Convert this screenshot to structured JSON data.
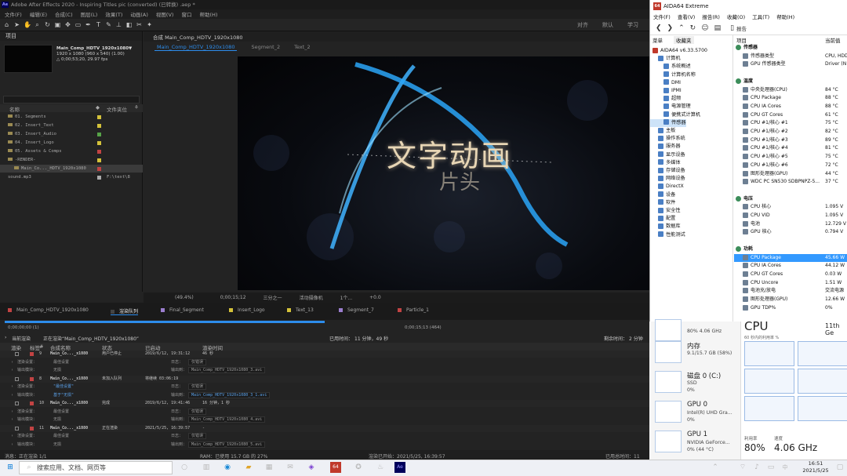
{
  "ae": {
    "title": "Adobe After Effects 2020 - Inspiring Titles pic (converted) (已转换) .aep *",
    "logo": "Ae",
    "menu": [
      "文件(F)",
      "编辑(E)",
      "合成(C)",
      "图层(L)",
      "效果(T)",
      "动画(A)",
      "视图(V)",
      "窗口",
      "帮助(H)"
    ],
    "tools_right": [
      "对齐",
      "默认",
      "学习"
    ],
    "project": {
      "tab": "项目",
      "comp_name": "Main_Comp_HDTV_1920x1080▼",
      "comp_size": "1920 x 1080 (960 x 540) (1.00)",
      "comp_dur": "△ 0;00;53;20, 29.97 fps",
      "col_name": "名称",
      "col_tag": "文件夹位",
      "items": [
        {
          "name": "01. Segments",
          "color": "#d4c23a"
        },
        {
          "name": "02. Insert_Text",
          "color": "#d4c23a"
        },
        {
          "name": "03. Insert_Audio",
          "color": "#56a448"
        },
        {
          "name": "04. Insert_Logo",
          "color": "#d4c23a"
        },
        {
          "name": "05. Assets & Comps",
          "color": "#c24343"
        },
        {
          "name": "-RENDER-",
          "color": "#d4c23a"
        },
        {
          "name": "Main_Co..._HDTV_1920x1080",
          "color": "#c24343"
        },
        {
          "name": "sound.mp3",
          "color": "#aaaaaa",
          "tag": "F:\\text\\8"
        }
      ]
    },
    "viewer": {
      "tab": "合成 Main_Comp_HDTV_1920x1080",
      "subtabs": [
        "Main_Comp_HDTV_1920x1080",
        "Segment_2",
        "Text_2"
      ],
      "title_main": "文字动画",
      "title_sub": "片头",
      "bar": [
        "(49.4%)",
        "0;00;15;12",
        "三分之一",
        "活动摄像机",
        "1个...",
        "+0.0"
      ]
    },
    "rq": {
      "tabs": [
        {
          "label": "Main_Comp_HDTV_1920x1080",
          "color": "#c24343"
        },
        {
          "label": "渲染队列",
          "color": "#444444"
        },
        {
          "label": "Final_Segment",
          "color": "#9b7ecf"
        },
        {
          "label": "Insert_Logo",
          "color": "#d4c23a"
        },
        {
          "label": "Text_13",
          "color": "#d4c23a"
        },
        {
          "label": "Segment_7",
          "color": "#9b7ecf"
        },
        {
          "label": "Particle_1",
          "color": "#c24343"
        }
      ],
      "progress": 0.5,
      "time_start": "0;00;00;00 (1)",
      "time_mid": "0;00;15;13 (464)",
      "status_label": "当前渲染",
      "status_text": "正在渲染“Main_Comp_HDTV_1920x1080”",
      "elapsed_label": "已用时间：",
      "elapsed": "11 分钟，49 秒",
      "remain_label": "剩余时间：",
      "remain": "2 分钟",
      "headers": [
        "渲染",
        "标签",
        "#",
        "合成名称",
        "状态",
        "已启动",
        "渲染时间"
      ],
      "rows": [
        {
          "type": "item",
          "num": "9",
          "name": "Main_Co..._x1080",
          "status": "用户已停止",
          "start": "2019/6/12, 19:31:12",
          "dur": "46 秒"
        },
        {
          "type": "sub",
          "label": "渲染设置：",
          "value": "最佳设置",
          "olabel": "日志：",
          "ovalue": "仅错误"
        },
        {
          "type": "sub",
          "label": "输出模块：",
          "value": "无损",
          "olabel": "输出到：",
          "ovalue": "Main_Comp_HDTV_1920x1080_3.avi"
        },
        {
          "type": "item",
          "num": "8",
          "name": "Main_Co..._x1080",
          "status": "未加入队列",
          "start": "将继续 03:06:19",
          "dur": ""
        },
        {
          "type": "sub",
          "label": "渲染设置：",
          "value": "\"最佳设置\"",
          "olabel": "日志：",
          "ovalue": "仅错误"
        },
        {
          "type": "sub",
          "label": "输出模块：",
          "value": "基于\"无损\"",
          "olabel": "输出到：",
          "ovalue": "Main_Comp_HDTV_1920x1080_3_1.avi"
        },
        {
          "type": "item",
          "num": "10",
          "name": "Main_Co..._x1080",
          "status": "完成",
          "start": "2019/6/12, 19:41:46",
          "dur": "16 分钟，1 秒"
        },
        {
          "type": "sub",
          "label": "渲染设置：",
          "value": "最佳设置",
          "olabel": "日志：",
          "ovalue": "仅错误"
        },
        {
          "type": "sub",
          "label": "输出模块：",
          "value": "无损",
          "olabel": "输出到：",
          "ovalue": "Main_Comp_HDTV_1920x1080_4.avi"
        },
        {
          "type": "item",
          "num": "11",
          "name": "Main_Co..._x1080",
          "status": "正在渲染",
          "start": "2021/5/25, 16:39:57",
          "dur": "-"
        },
        {
          "type": "sub",
          "label": "渲染设置：",
          "value": "最佳设置",
          "olabel": "日志：",
          "ovalue": "仅错误"
        },
        {
          "type": "sub",
          "label": "输出模块：",
          "value": "无损",
          "olabel": "输出到：",
          "ovalue": "Main_Comp_HDTV_1920x1080_5.avi"
        }
      ],
      "foot_msg": "消息：正在渲染 1/1",
      "foot_ram": "RAM：已使用 15.7 GB 的 27%",
      "foot_start": "渲染已开始：2021/5/25, 16:39:57",
      "foot_elapsed": "已用总时间：11"
    }
  },
  "aida": {
    "title": "AIDA64 Extreme",
    "logo": "64",
    "menu": [
      "文件(F)",
      "查看(V)",
      "报告(R)",
      "收藏(O)",
      "工具(T)",
      "帮助(H)"
    ],
    "report": "报告",
    "tree_tabs": [
      "菜单",
      "收藏夹"
    ],
    "col_item": "项目",
    "col_value": "当前值",
    "tree": [
      {
        "label": "AIDA64 v6.33.5700",
        "indent": 0
      },
      {
        "label": "计算机",
        "indent": 1
      },
      {
        "label": "系统概述",
        "indent": 2
      },
      {
        "label": "计算机名称",
        "indent": 2
      },
      {
        "label": "DMI",
        "indent": 2
      },
      {
        "label": "IPMI",
        "indent": 2
      },
      {
        "label": "超频",
        "indent": 2
      },
      {
        "label": "电源管理",
        "indent": 2
      },
      {
        "label": "便携式计算机",
        "indent": 2
      },
      {
        "label": "传感器",
        "indent": 2,
        "sel": true
      },
      {
        "label": "主板",
        "indent": 1
      },
      {
        "label": "操作系统",
        "indent": 1
      },
      {
        "label": "服务器",
        "indent": 1
      },
      {
        "label": "显示设备",
        "indent": 1
      },
      {
        "label": "多媒体",
        "indent": 1
      },
      {
        "label": "存储设备",
        "indent": 1
      },
      {
        "label": "网络设备",
        "indent": 1
      },
      {
        "label": "DirectX",
        "indent": 1
      },
      {
        "label": "设备",
        "indent": 1
      },
      {
        "label": "软件",
        "indent": 1
      },
      {
        "label": "安全性",
        "indent": 1
      },
      {
        "label": "配置",
        "indent": 1
      },
      {
        "label": "数据库",
        "indent": 1
      },
      {
        "label": "性能测试",
        "indent": 1
      }
    ],
    "list": [
      {
        "label": "传感器",
        "value": "",
        "sec": true
      },
      {
        "label": "传感器类型",
        "value": "CPU, HDD"
      },
      {
        "label": "GPU 传感器类型",
        "value": "Driver (N"
      },
      {
        "label": "",
        "value": "",
        "blank": true
      },
      {
        "label": "温度",
        "value": "",
        "sec": true
      },
      {
        "label": "中央处理器(CPU)",
        "value": "84 °C"
      },
      {
        "label": "CPU Package",
        "value": "88 °C"
      },
      {
        "label": "CPU IA Cores",
        "value": "88 °C"
      },
      {
        "label": "CPU GT Cores",
        "value": "61 °C"
      },
      {
        "label": "CPU #1/核心 #1",
        "value": "75 °C"
      },
      {
        "label": "CPU #1/核心 #2",
        "value": "82 °C"
      },
      {
        "label": "CPU #1/核心 #3",
        "value": "89 °C"
      },
      {
        "label": "CPU #1/核心 #4",
        "value": "81 °C"
      },
      {
        "label": "CPU #1/核心 #5",
        "value": "75 °C"
      },
      {
        "label": "CPU #1/核心 #6",
        "value": "72 °C"
      },
      {
        "label": "图形处理器(GPU)",
        "value": "44 °C"
      },
      {
        "label": "WDC PC SN530 SDBPNPZ-5...",
        "value": "37 °C"
      },
      {
        "label": "",
        "value": "",
        "blank": true
      },
      {
        "label": "电压",
        "value": "",
        "sec": true
      },
      {
        "label": "CPU 核心",
        "value": "1.095 V"
      },
      {
        "label": "CPU VID",
        "value": "1.095 V"
      },
      {
        "label": "电池",
        "value": "12.729 V"
      },
      {
        "label": "GPU 核心",
        "value": "0.794 V"
      },
      {
        "label": "",
        "value": "",
        "blank": true
      },
      {
        "label": "功耗",
        "value": "",
        "sec": true
      },
      {
        "label": "CPU Package",
        "value": "45.66 W",
        "sel": true
      },
      {
        "label": "CPU IA Cores",
        "value": "44.12 W"
      },
      {
        "label": "CPU GT Cores",
        "value": "0.03 W"
      },
      {
        "label": "CPU Uncore",
        "value": "1.51 W"
      },
      {
        "label": "电池充/放电",
        "value": "交流电源"
      },
      {
        "label": "图形处理器(GPU)",
        "value": "12.66 W"
      },
      {
        "label": "GPU TDP%",
        "value": "0%"
      }
    ]
  },
  "taskmgr": {
    "cards": [
      {
        "name": "",
        "s1": "80% 4.06 GHz",
        "s2": ""
      },
      {
        "name": "内存",
        "s1": "9.1/15.7 GB (58%)",
        "s2": ""
      },
      {
        "name": "磁盘 0 (C:)",
        "s1": "SSD",
        "s2": "0%"
      },
      {
        "name": "GPU 0",
        "s1": "Intel(R) UHD Gra...",
        "s2": "0%"
      },
      {
        "name": "GPU 1",
        "s1": "NVIDIA GeForce...",
        "s2": "0% (44 °C)"
      }
    ],
    "cpu_title": "CPU",
    "cpu_model": "11th Ge",
    "graph_caption": "60 秒内的利用率 %",
    "util_label": "利用率",
    "speed_label": "速度",
    "util": "80%",
    "speed": "4.06 GHz"
  },
  "taskbar": {
    "search_placeholder": "搜索应用、文档、网页等",
    "time": "16:51",
    "date": "2021/5/25"
  }
}
